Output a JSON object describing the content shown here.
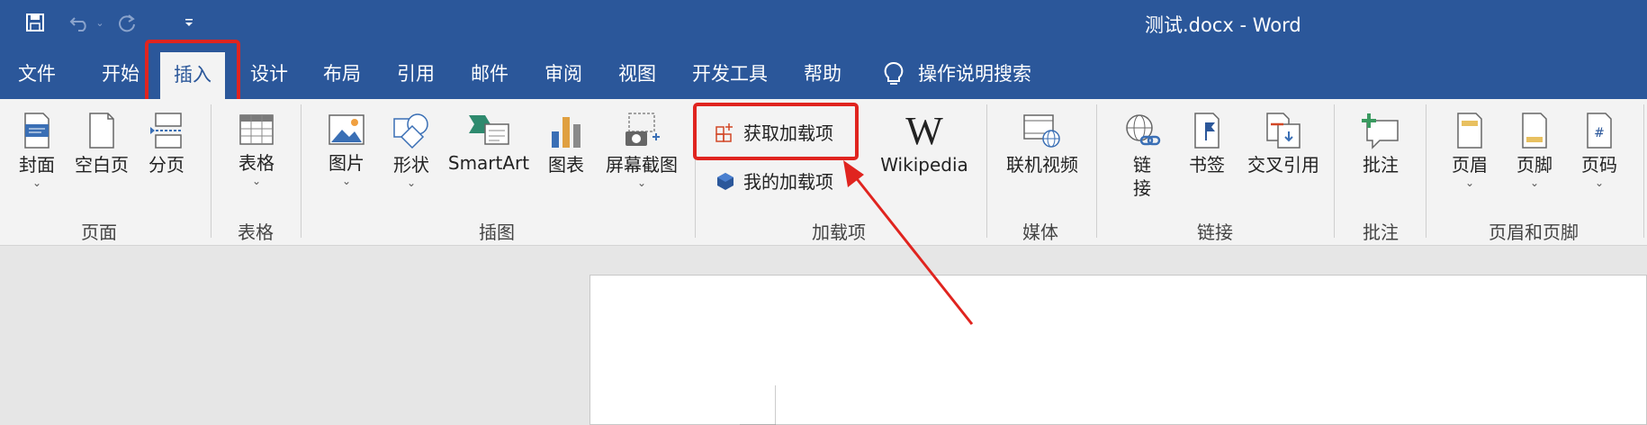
{
  "window": {
    "title": "测试.docx  -  Word"
  },
  "quick_access": {
    "save": "save-icon",
    "undo": "undo-icon",
    "redo": "redo-icon",
    "customize": "customize-icon"
  },
  "tabs": [
    {
      "label": "文件"
    },
    {
      "label": "开始"
    },
    {
      "label": "插入"
    },
    {
      "label": "设计"
    },
    {
      "label": "布局"
    },
    {
      "label": "引用"
    },
    {
      "label": "邮件"
    },
    {
      "label": "审阅"
    },
    {
      "label": "视图"
    },
    {
      "label": "开发工具"
    },
    {
      "label": "帮助"
    }
  ],
  "search": {
    "label": "操作说明搜索",
    "icon": "lightbulb-icon"
  },
  "ribbon": {
    "pages": {
      "label": "页面",
      "cover": "封面",
      "blank": "空白页",
      "break": "分页"
    },
    "tables": {
      "label": "表格",
      "table": "表格"
    },
    "illustrations": {
      "label": "插图",
      "pictures": "图片",
      "shapes": "形状",
      "smartart": "SmartArt",
      "chart": "图表",
      "screenshot": "屏幕截图"
    },
    "addins": {
      "label": "加载项",
      "get": "获取加载项",
      "my": "我的加载项",
      "wikipedia": "Wikipedia"
    },
    "media": {
      "label": "媒体",
      "video": "联机视频"
    },
    "links": {
      "label": "链接",
      "link_line1": "链",
      "link_line2": "接",
      "bookmark": "书签",
      "crossref": "交叉引用"
    },
    "comments": {
      "label": "批注",
      "comment": "批注"
    },
    "header_footer": {
      "label": "页眉和页脚",
      "header": "页眉",
      "footer": "页脚",
      "page_number": "页码"
    }
  },
  "colors": {
    "accent": "#2b579a",
    "highlight": "#e0241f"
  }
}
